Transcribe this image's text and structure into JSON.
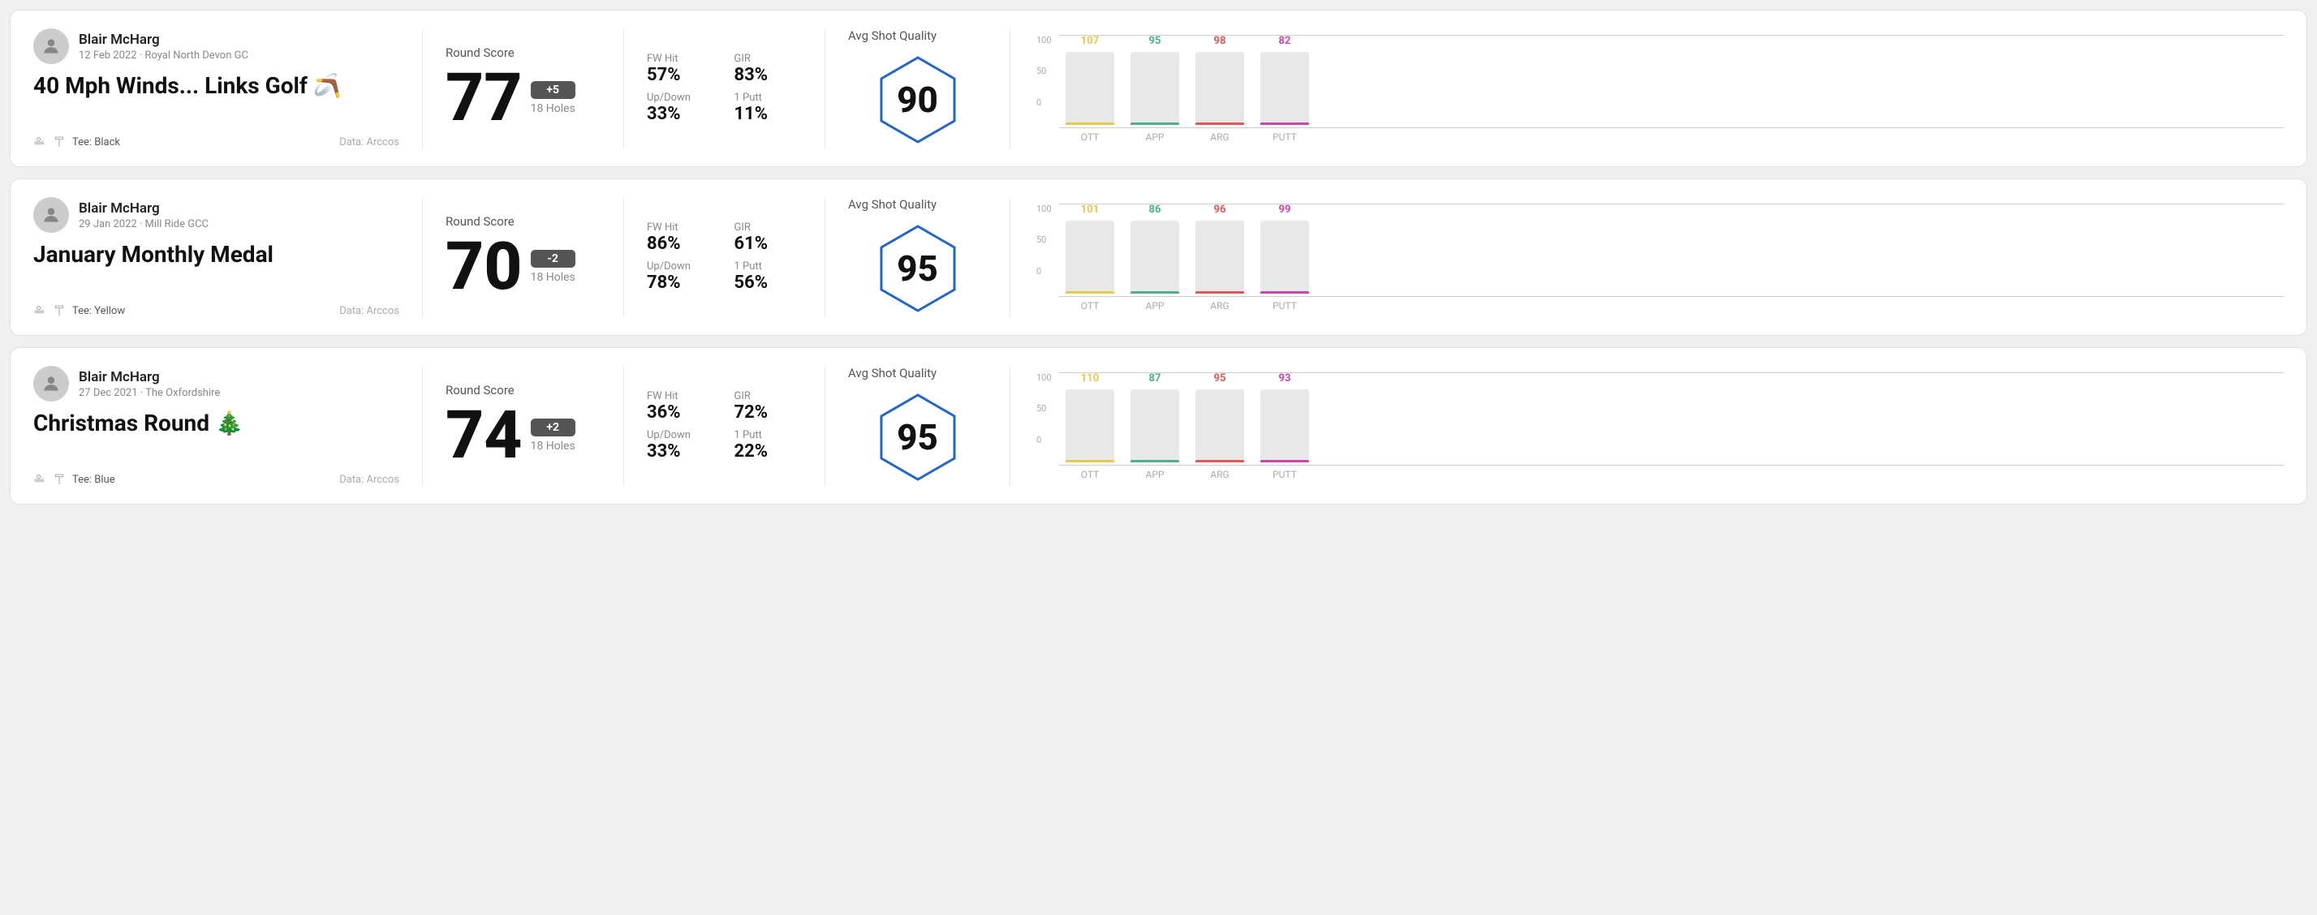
{
  "rounds": [
    {
      "id": "round1",
      "user_name": "Blair McHarg",
      "date_venue": "12 Feb 2022 · Royal North Devon GC",
      "title": "40 Mph Winds... Links Golf",
      "title_emoji": "🪃",
      "tee": "Black",
      "data_source": "Data: Arccos",
      "score": "77",
      "score_diff": "+5",
      "score_diff_type": "plus",
      "holes": "18 Holes",
      "fw_hit": "57%",
      "gir": "83%",
      "up_down": "33%",
      "one_putt": "11%",
      "avg_quality": "90",
      "chart": {
        "ott": {
          "value": 107,
          "color": "#e6c84a"
        },
        "app": {
          "value": 95,
          "color": "#4caf8a"
        },
        "arg": {
          "value": 98,
          "color": "#e05555"
        },
        "putt": {
          "value": 82,
          "color": "#cc44aa"
        }
      }
    },
    {
      "id": "round2",
      "user_name": "Blair McHarg",
      "date_venue": "29 Jan 2022 · Mill Ride GCC",
      "title": "January Monthly Medal",
      "title_emoji": "",
      "tee": "Yellow",
      "data_source": "Data: Arccos",
      "score": "70",
      "score_diff": "-2",
      "score_diff_type": "minus",
      "holes": "18 Holes",
      "fw_hit": "86%",
      "gir": "61%",
      "up_down": "78%",
      "one_putt": "56%",
      "avg_quality": "95",
      "chart": {
        "ott": {
          "value": 101,
          "color": "#e6c84a"
        },
        "app": {
          "value": 86,
          "color": "#4caf8a"
        },
        "arg": {
          "value": 96,
          "color": "#e05555"
        },
        "putt": {
          "value": 99,
          "color": "#cc44aa"
        }
      }
    },
    {
      "id": "round3",
      "user_name": "Blair McHarg",
      "date_venue": "27 Dec 2021 · The Oxfordshire",
      "title": "Christmas Round",
      "title_emoji": "🎄",
      "tee": "Blue",
      "data_source": "Data: Arccos",
      "score": "74",
      "score_diff": "+2",
      "score_diff_type": "plus",
      "holes": "18 Holes",
      "fw_hit": "36%",
      "gir": "72%",
      "up_down": "33%",
      "one_putt": "22%",
      "avg_quality": "95",
      "chart": {
        "ott": {
          "value": 110,
          "color": "#e6c84a"
        },
        "app": {
          "value": 87,
          "color": "#4caf8a"
        },
        "arg": {
          "value": 95,
          "color": "#e05555"
        },
        "putt": {
          "value": 93,
          "color": "#cc44aa"
        }
      }
    }
  ],
  "labels": {
    "round_score": "Round Score",
    "fw_hit": "FW Hit",
    "gir": "GIR",
    "up_down": "Up/Down",
    "one_putt": "1 Putt",
    "avg_shot_quality": "Avg Shot Quality",
    "ott": "OTT",
    "app": "APP",
    "arg": "ARG",
    "putt": "PUTT",
    "tee_prefix": "Tee: ",
    "y_100": "100",
    "y_50": "50",
    "y_0": "0"
  }
}
